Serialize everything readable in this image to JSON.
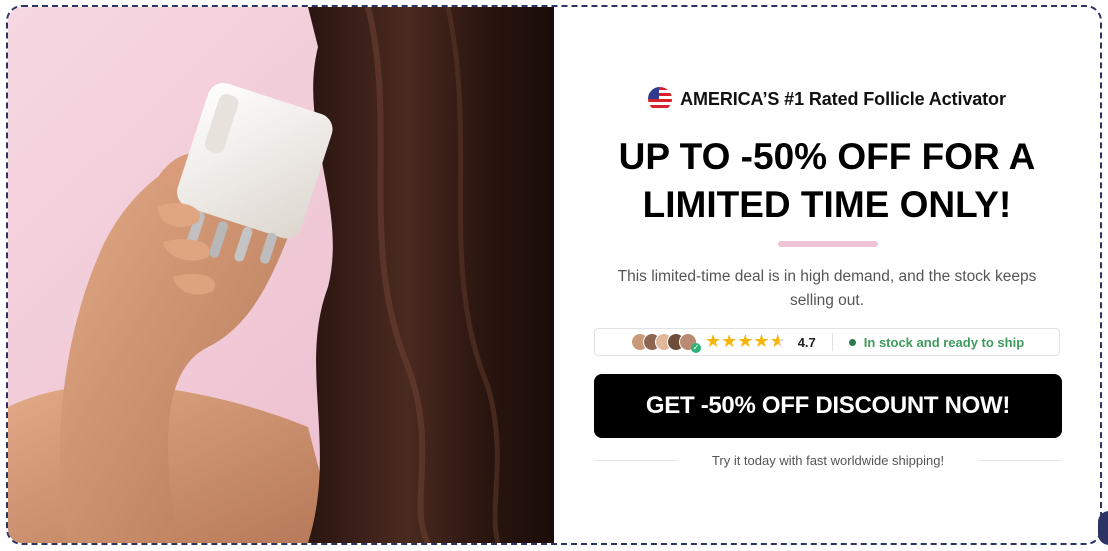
{
  "badge": {
    "text": "AMERICA’S #1 Rated Follicle Activator",
    "icon": "us-flag-icon"
  },
  "headline": {
    "line1": "UP TO -50% OFF FOR A",
    "line2": "LIMITED TIME ONLY!"
  },
  "description": "This limited-time deal is in high demand, and the stock keeps selling out.",
  "social_proof": {
    "rating": "4.7",
    "stars": 4.7,
    "stock_text": "In stock and ready to ship"
  },
  "cta": {
    "label": "GET -50% OFF DISCOUNT NOW!"
  },
  "footer_note": "Try it today with fast worldwide shipping!",
  "colors": {
    "accent_divider": "#eec3d3",
    "cta_bg": "#000000",
    "star": "#f6b40e",
    "stock_green": "#3f9a5f",
    "frame_border": "#2d3463"
  }
}
